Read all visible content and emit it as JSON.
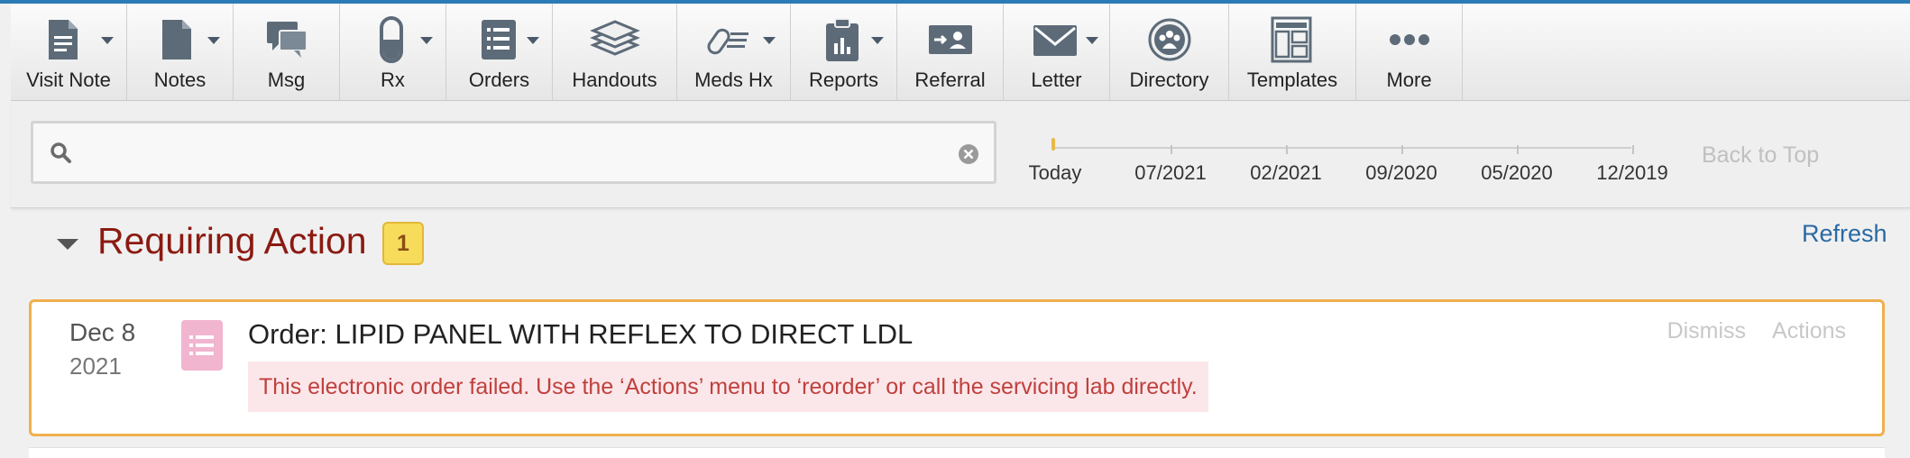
{
  "toolbar": {
    "items": [
      {
        "label": "Visit Note",
        "icon": "visit-note-icon"
      },
      {
        "label": "Notes",
        "icon": "notes-icon"
      },
      {
        "label": "Msg",
        "icon": "msg-icon"
      },
      {
        "label": "Rx",
        "icon": "rx-icon"
      },
      {
        "label": "Orders",
        "icon": "orders-icon"
      },
      {
        "label": "Handouts",
        "icon": "handouts-icon"
      },
      {
        "label": "Meds Hx",
        "icon": "meds-hx-icon"
      },
      {
        "label": "Reports",
        "icon": "reports-icon"
      },
      {
        "label": "Referral",
        "icon": "referral-icon"
      },
      {
        "label": "Letter",
        "icon": "letter-icon"
      },
      {
        "label": "Directory",
        "icon": "directory-icon"
      },
      {
        "label": "Templates",
        "icon": "templates-icon"
      },
      {
        "label": "More",
        "icon": "more-icon"
      }
    ]
  },
  "search": {
    "value": "",
    "placeholder": ""
  },
  "timeline": {
    "labels": [
      "Today",
      "07/2021",
      "02/2021",
      "09/2020",
      "05/2020",
      "12/2019"
    ]
  },
  "back_to_top": "Back to Top",
  "section": {
    "title": "Requiring Action",
    "count": "1",
    "refresh": "Refresh"
  },
  "item": {
    "date": "Dec 8",
    "year": "2021",
    "title": "Order: LIPID PANEL WITH REFLEX TO DIRECT LDL",
    "dismiss": "Dismiss",
    "actions": "Actions",
    "alert": "This electronic order failed. Use the ‘Actions’ menu to ‘reorder’ or call the servicing lab directly."
  },
  "colors": {
    "accent_blue": "#2a6aa4",
    "section_title": "#8b1a12",
    "badge": "#f7dc5c",
    "card_border": "#f0b04d",
    "alert_text": "#c0403d",
    "alert_bg": "#fbe7ea"
  }
}
